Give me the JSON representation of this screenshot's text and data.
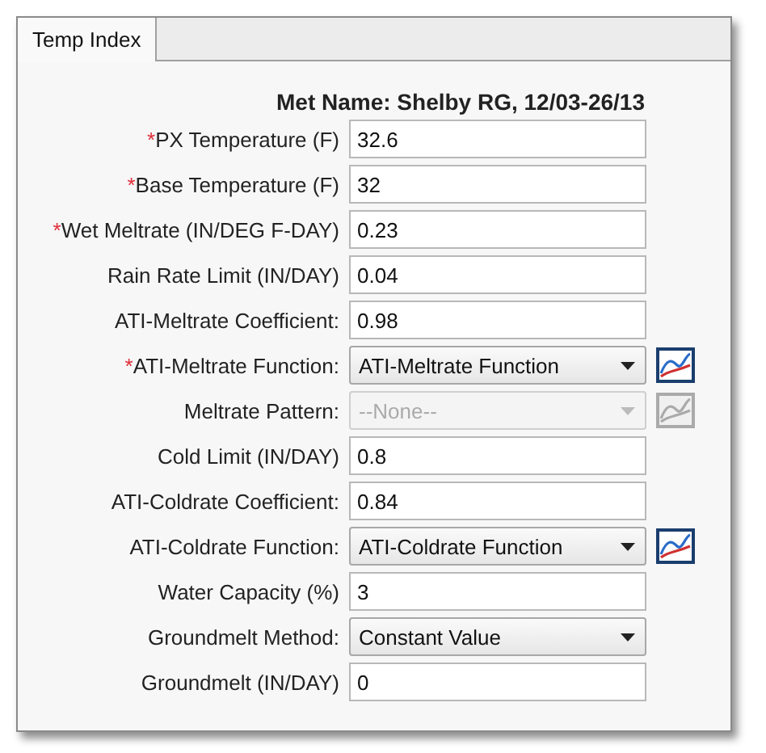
{
  "tabs": [
    {
      "label": "Temp Index",
      "selected": true
    }
  ],
  "met_name": "Met Name: Shelby RG, 12/03-26/13",
  "fields": [
    {
      "kind": "text",
      "label": "PX Temperature (F)",
      "required_mark": "*",
      "value": "32.6"
    },
    {
      "kind": "text",
      "label": "Base Temperature (F)",
      "required_mark": "*",
      "value": "32"
    },
    {
      "kind": "text",
      "label": "Wet Meltrate (IN/DEG F-DAY)",
      "required_mark": "*",
      "value": "0.23"
    },
    {
      "kind": "text",
      "label": "Rain Rate Limit (IN/DAY)",
      "value": "0.04"
    },
    {
      "kind": "text",
      "label": "ATI-Meltrate Coefficient:",
      "value": "0.98"
    },
    {
      "kind": "select",
      "label": "ATI-Meltrate Function:",
      "required_mark": "*",
      "value": "ATI-Meltrate Function",
      "disabled": false,
      "chart_button": true
    },
    {
      "kind": "select",
      "label": "Meltrate Pattern:",
      "value": "--None--",
      "disabled": true,
      "chart_button": true
    },
    {
      "kind": "text",
      "label": "Cold Limit (IN/DAY)",
      "value": "0.8"
    },
    {
      "kind": "text",
      "label": "ATI-Coldrate Coefficient:",
      "value": "0.84"
    },
    {
      "kind": "select",
      "label": "ATI-Coldrate Function:",
      "value": "ATI-Coldrate Function",
      "disabled": false,
      "chart_button": true
    },
    {
      "kind": "text",
      "label": "Water Capacity (%)",
      "value": "3"
    },
    {
      "kind": "select",
      "label": "Groundmelt Method:",
      "value": "Constant Value",
      "disabled": false,
      "chart_button": false
    },
    {
      "kind": "text",
      "label": "Groundmelt (IN/DAY)",
      "value": "0"
    }
  ]
}
